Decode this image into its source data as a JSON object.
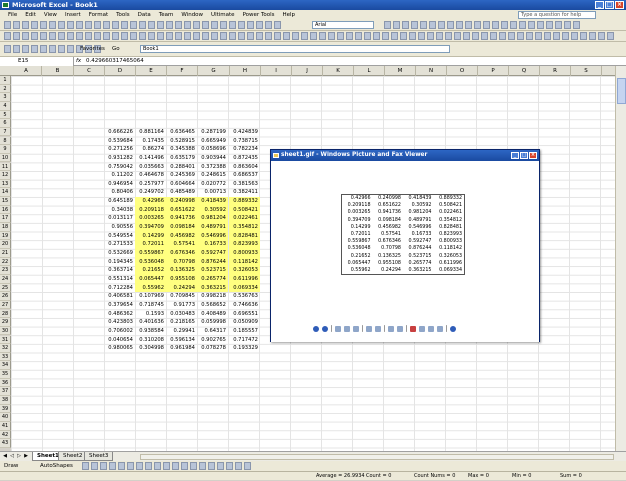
{
  "app": {
    "title": "Microsoft Excel - Book1"
  },
  "menu": [
    "File",
    "Edit",
    "View",
    "Insert",
    "Format",
    "Tools",
    "Data",
    "Team",
    "Window",
    "Ultimate",
    "Power Tools",
    "Help"
  ],
  "help_box": "Type a question for help",
  "toolbar": {
    "font": "Arial",
    "favorites": "Favorites",
    "go": "Go",
    "book": "Book1"
  },
  "formula": {
    "namebox": "E15",
    "fx": "fx",
    "value": "0.429660317465064"
  },
  "columns": [
    "A",
    "B",
    "C",
    "D",
    "E",
    "F",
    "G",
    "H",
    "I",
    "J",
    "K",
    "L",
    "M",
    "N",
    "O",
    "P",
    "Q",
    "R",
    "S"
  ],
  "rows": [
    "1",
    "2",
    "3",
    "4",
    "5",
    "6",
    "7",
    "8",
    "9",
    "10",
    "11",
    "12",
    "13",
    "14",
    "15",
    "16",
    "17",
    "18",
    "19",
    "20",
    "21",
    "22",
    "23",
    "24",
    "25",
    "26",
    "27",
    "28",
    "29",
    "30",
    "31",
    "32",
    "33",
    "34",
    "35",
    "36",
    "37",
    "38",
    "39",
    "40",
    "41",
    "42",
    "43"
  ],
  "sheet": {
    "D": [
      "0.666226",
      "0.539684",
      "0.271256",
      "0.931282",
      "0.759042",
      "0.11202",
      "0.946954",
      "0.80406",
      "0.645189",
      "0.34038",
      "0.013117",
      "0.90556",
      "0.549554",
      "0.271533",
      "0.532669",
      "0.194345",
      "0.363714",
      "0.551314",
      "0.712284",
      "0.406581",
      "0.379654",
      "0.486362",
      "0.423803",
      "0.706002",
      "0.040654",
      "0.980065"
    ],
    "E": [
      "0.881164",
      "0.17435",
      "0.86274",
      "0.141496",
      "0.035663",
      "0.464678",
      "0.257977",
      "0.249702",
      "0.42966",
      "0.209118",
      "0.003265",
      "0.394709",
      "0.14299",
      "0.72011",
      "0.559867",
      "0.536048",
      "0.21652",
      "0.065447",
      "0.55962",
      "0.107969",
      "0.718745",
      "0.1593",
      "0.401636",
      "0.938584",
      "0.310208",
      "0.304998"
    ],
    "F": [
      "0.636465",
      "0.528915",
      "0.345388",
      "0.635179",
      "0.288401",
      "0.245369",
      "0.604664",
      "0.485489",
      "0.240998",
      "0.651622",
      "0.941736",
      "0.098184",
      "0.456982",
      "0.57541",
      "0.676346",
      "0.70798",
      "0.136325",
      "0.955108",
      "0.24294",
      "0.709845",
      "0.91773",
      "0.030483",
      "0.218165",
      "0.29941",
      "0.596134",
      "0.961984"
    ],
    "G": [
      "0.287199",
      "0.665949",
      "0.058696",
      "0.903944",
      "0.372388",
      "0.248615",
      "0.020772",
      "0.00713",
      "0.418439",
      "0.30592",
      "0.981204",
      "0.489791",
      "0.546996",
      "0.16733",
      "0.592747",
      "0.876244",
      "0.523715",
      "0.265774",
      "0.363215",
      "0.998218",
      "0.568652",
      "0.408489",
      "0.059998",
      "0.64317",
      "0.902765",
      "0.078278"
    ],
    "H": [
      "0.424839",
      "0.738715",
      "0.782234",
      "0.872435",
      "0.863604",
      "0.686537",
      "0.381563",
      "0.382411",
      "0.889332",
      "0.508421",
      "0.022461",
      "0.354812",
      "0.828481",
      "0.823993",
      "0.800933",
      "0.118142",
      "0.326053",
      "0.611996",
      "0.069334",
      "0.536763",
      "0.746636",
      "0.696551",
      "0.050909",
      "0.185557",
      "0.717472",
      "0.193329"
    ]
  },
  "viewer": {
    "title": "sheet1.gif - Windows Picture and Fax Viewer",
    "rows": [
      [
        "0.42966",
        "0.240998",
        "0.418439",
        "0.889332"
      ],
      [
        "0.209118",
        "0.651622",
        "0.30592",
        "0.508421"
      ],
      [
        "0.003265",
        "0.941736",
        "0.981204",
        "0.022461"
      ],
      [
        "0.394709",
        "0.098184",
        "0.489791",
        "0.354812"
      ],
      [
        "0.14299",
        "0.456982",
        "0.546996",
        "0.828481"
      ],
      [
        "0.72011",
        "0.57541",
        "0.16733",
        "0.823993"
      ],
      [
        "0.559867",
        "0.676346",
        "0.592747",
        "0.800933"
      ],
      [
        "0.536048",
        "0.70798",
        "0.876244",
        "0.118142"
      ],
      [
        "0.21652",
        "0.136325",
        "0.523715",
        "0.326053"
      ],
      [
        "0.065447",
        "0.955108",
        "0.265774",
        "0.611996"
      ],
      [
        "0.55962",
        "0.24294",
        "0.363215",
        "0.069334"
      ]
    ]
  },
  "tabs": [
    "Sheet1",
    "Sheet2",
    "Sheet3"
  ],
  "drawbar": {
    "draw": "Draw",
    "autoshapes": "AutoShapes"
  },
  "status": {
    "average": "Average = 26.9934",
    "count": "Count = 0",
    "count_nums": "Count Nums = 0",
    "max": "Max = 0",
    "min": "Min = 0",
    "sum": "Sum = 0"
  },
  "colors": {
    "highlight": "#ffff80",
    "titlebar": "#1a4aa0"
  }
}
